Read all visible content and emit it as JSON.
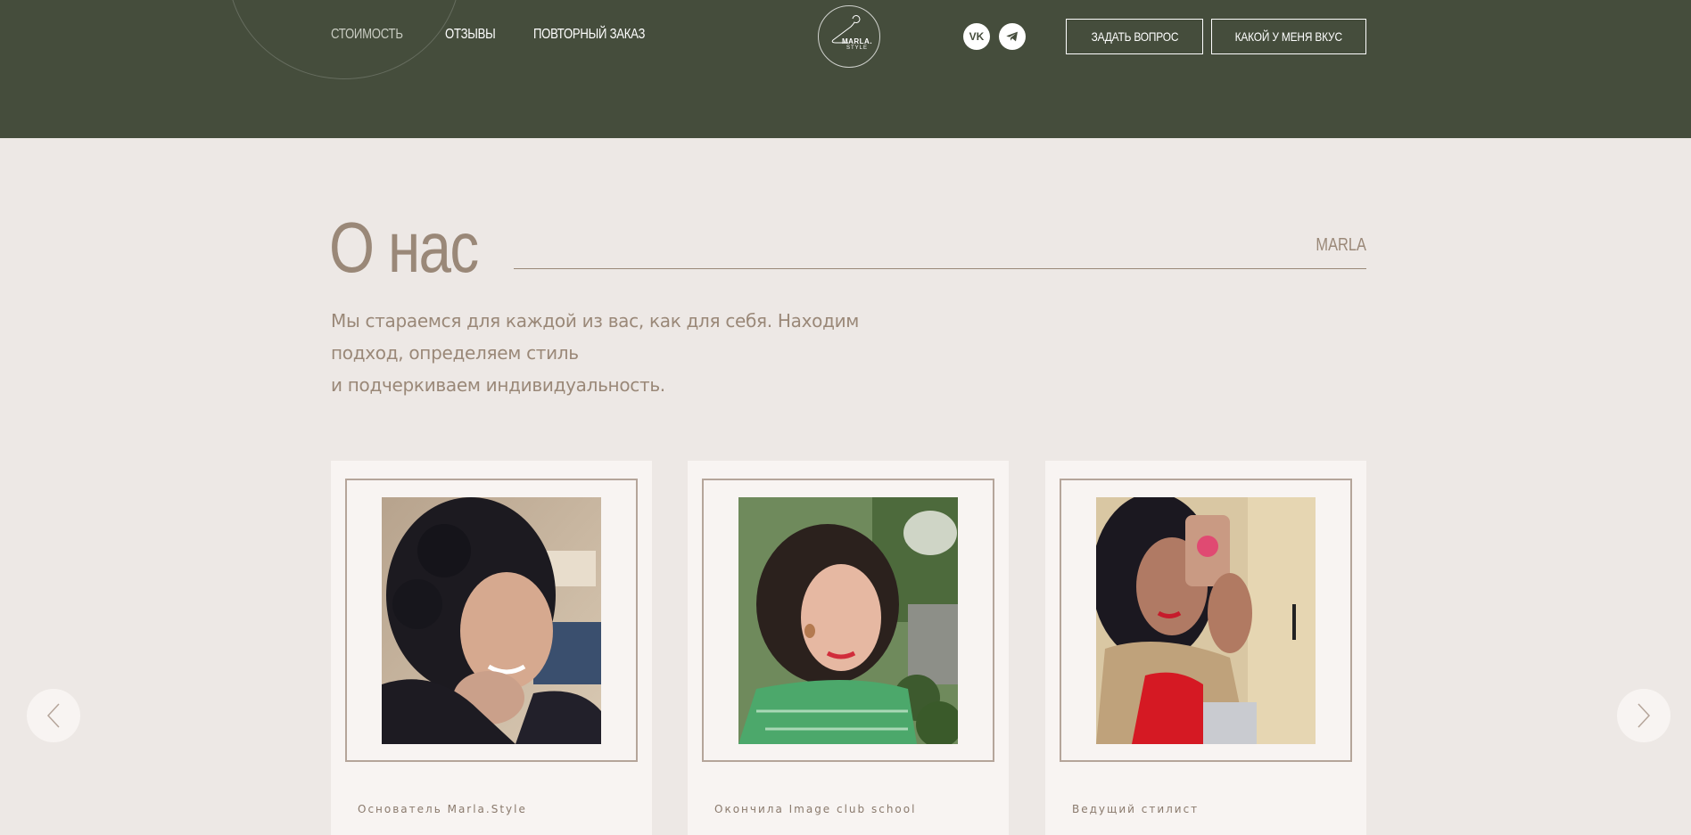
{
  "header": {
    "nav": [
      {
        "label": "СТОИМОСТЬ",
        "active": false
      },
      {
        "label": "ОТЗЫВЫ",
        "active": true
      },
      {
        "label": "ПОВТОРНЫЙ ЗАКАЗ",
        "active": true
      }
    ],
    "logo": {
      "line1": "MARLA.",
      "line2": "STYLE"
    },
    "social": [
      {
        "name": "vk",
        "label": "VK"
      },
      {
        "name": "telegram",
        "label": ""
      }
    ],
    "buttons": {
      "ask": "ЗАДАТЬ ВОПРОС",
      "taste": "КАКОЙ У МЕНЯ ВКУС"
    },
    "colors": {
      "bg": "#454d3c",
      "text": "#ffffff"
    }
  },
  "about": {
    "title": "О нас",
    "brand_label": "MARLA",
    "intro_lines": [
      "Мы стараемся для каждой из вас, как для себя. Находим",
      "подход, определяем стиль",
      "и подчеркиваем индивидуальность."
    ],
    "colors": {
      "accent": "#9a8878",
      "bg": "#ede8e5"
    }
  },
  "team": [
    {
      "caption": "Основатель Marla.Style",
      "photo": "portrait-curly-hair-smiling"
    },
    {
      "caption": "Окончила Image club school",
      "photo": "portrait-green-gingham-dress"
    },
    {
      "caption": "Ведущий стилист",
      "photo": "mirror-selfie-trench-coat"
    }
  ],
  "carousel": {
    "prev": "chevron-left-icon",
    "next": "chevron-right-icon"
  }
}
